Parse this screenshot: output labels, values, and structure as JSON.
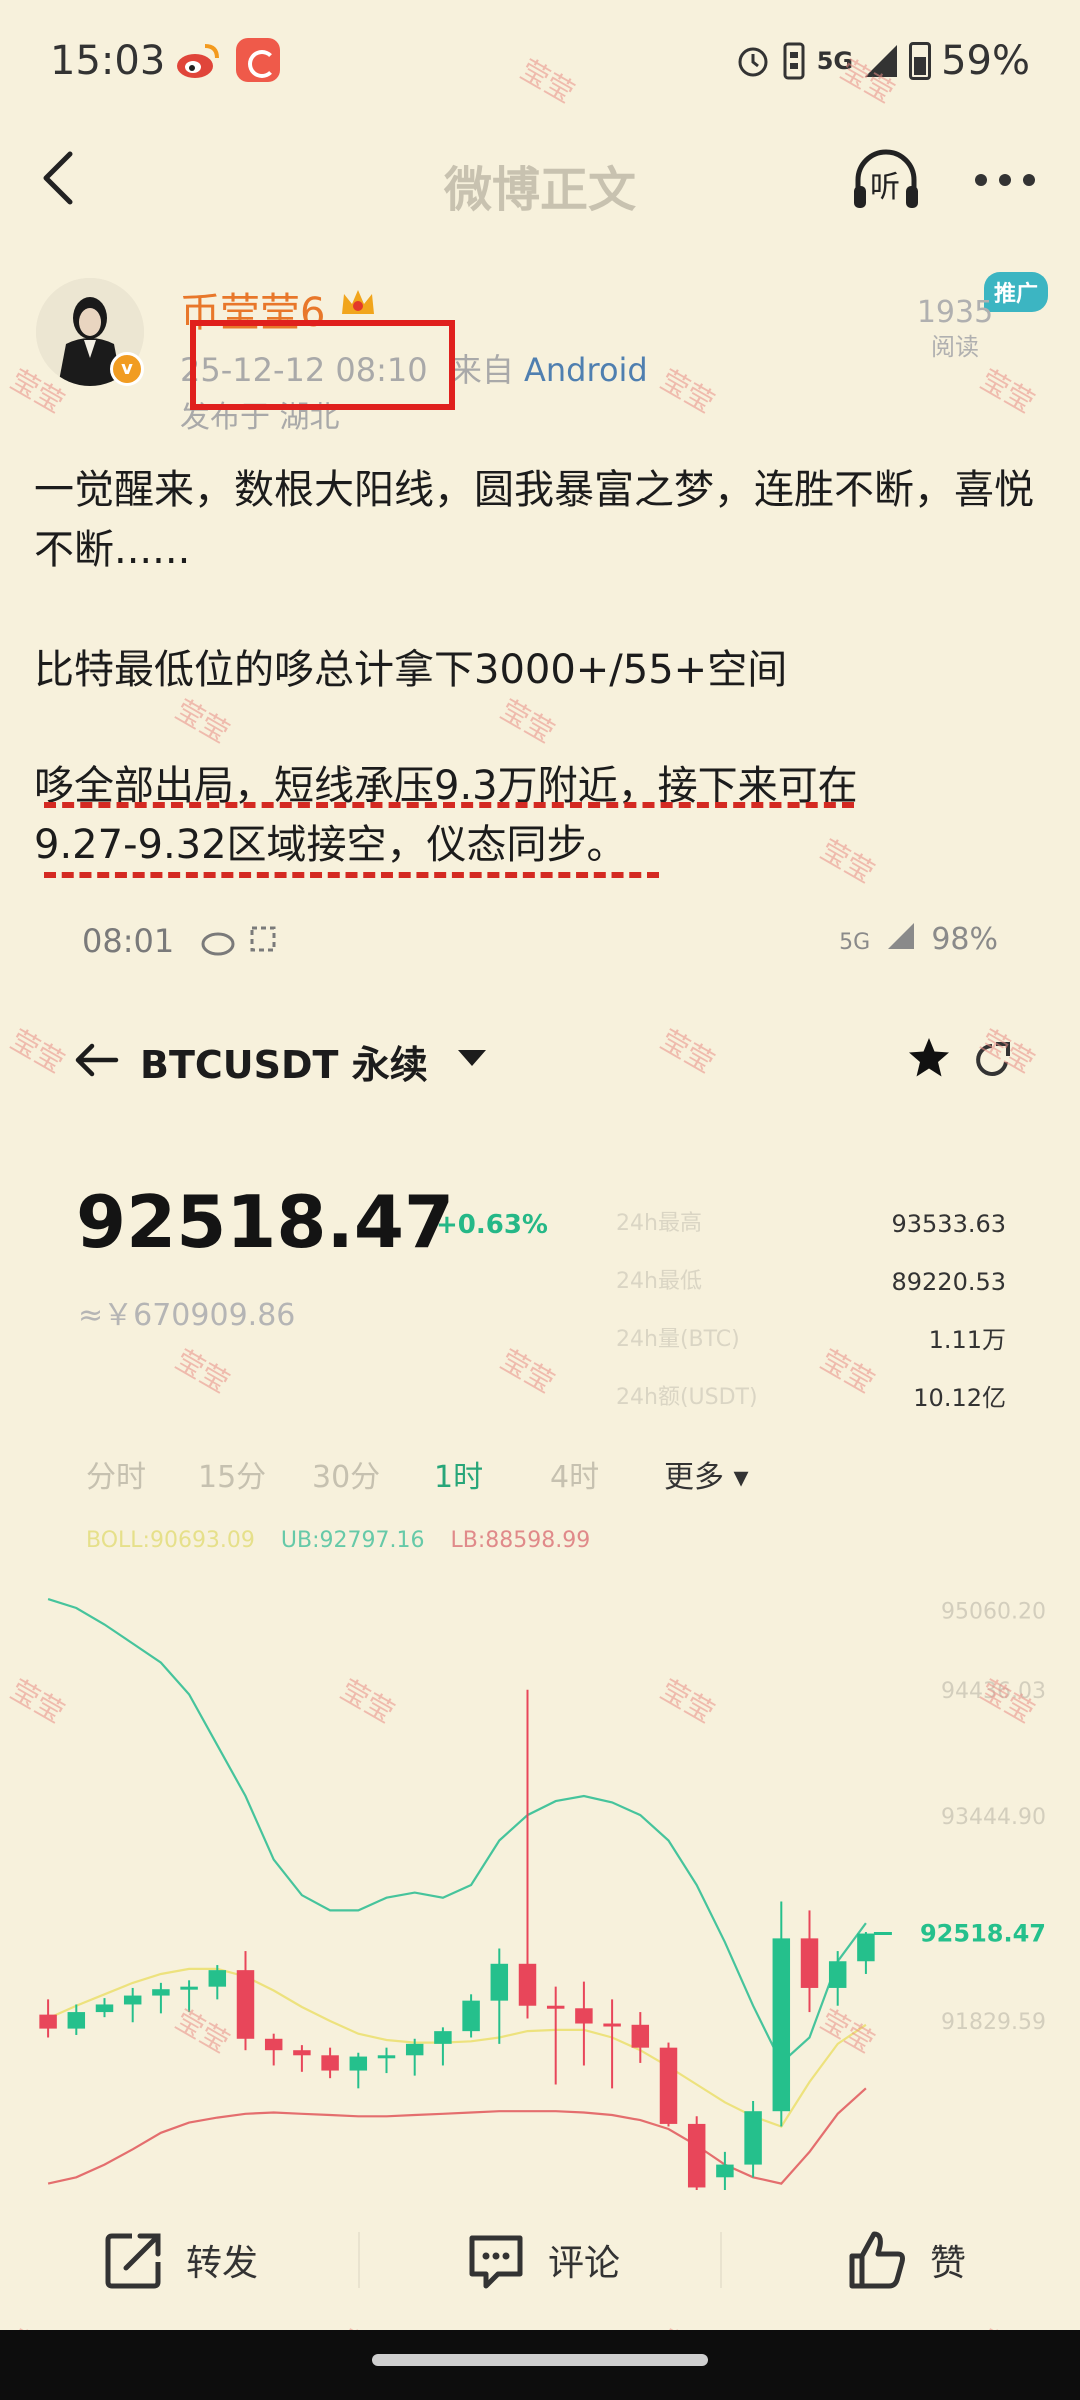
{
  "status_bar": {
    "time": "15:03",
    "network": "5G",
    "battery": "59%"
  },
  "nav": {
    "title": "微博正文",
    "listen": "听"
  },
  "author": {
    "name": "币莹莹6",
    "verified_mark": "v",
    "date": "25-12-12 08:10",
    "source_prefix": "来自",
    "source": "Android",
    "location": "发布于 湖北",
    "read_count": "1935",
    "read_label": "阅读",
    "promo": "推广"
  },
  "post": {
    "para1": "一觉醒来，数根大阳线，圆我暴富之梦，连胜不断，喜悦不断......",
    "para2": "比特最低位的哆总计拿下3000+/55+空间",
    "para3_line1": "哆全部出局，短线承压9.3万附近，接下来可在",
    "para3_line2": "9.27-9.32区域接空，仪态同步。"
  },
  "embedded": {
    "status_time": "08:01",
    "status_network": "5G",
    "status_battery": "98%",
    "symbol": "BTCUSDT 永续",
    "price": "92518.47",
    "change": "+0.63%",
    "price_cny": "≈￥670909.86",
    "stats": {
      "labels": [
        "24h最高",
        "24h最低",
        "24h量(BTC)",
        "24h额(USDT)"
      ],
      "values": [
        "93533.63",
        "89220.53",
        "1.11万",
        "10.12亿"
      ]
    },
    "timeframes": [
      "分时",
      "15分",
      "30分",
      "1时",
      "4时",
      "更多"
    ],
    "active_timeframe": "1时",
    "indicators": {
      "boll": "BOLL:90693.09",
      "ub": "UB:92797.16",
      "lb": "LB:88598.99"
    }
  },
  "chart_data": {
    "type": "candlestick",
    "title": "",
    "price_axis_labels": [
      "95060.20",
      "94436.03",
      "93444.90",
      "92518.47",
      "91829.59"
    ],
    "last_price": 92518.47,
    "ylim": [
      90500,
      95300
    ],
    "colors": {
      "up": "#25c08c",
      "down": "#e8465a",
      "ub": "#46c49c",
      "mid": "#ede27d",
      "lb": "#e46e6e"
    },
    "candles": [
      {
        "o": 91880,
        "h": 92000,
        "l": 91700,
        "c": 91770
      },
      {
        "o": 91770,
        "h": 91960,
        "l": 91720,
        "c": 91900
      },
      {
        "o": 91900,
        "h": 92010,
        "l": 91860,
        "c": 91960
      },
      {
        "o": 91960,
        "h": 92090,
        "l": 91820,
        "c": 92030
      },
      {
        "o": 92030,
        "h": 92130,
        "l": 91890,
        "c": 92080
      },
      {
        "o": 92080,
        "h": 92150,
        "l": 91900,
        "c": 92100
      },
      {
        "o": 92100,
        "h": 92270,
        "l": 92000,
        "c": 92230
      },
      {
        "o": 92230,
        "h": 92380,
        "l": 91600,
        "c": 91690
      },
      {
        "o": 91690,
        "h": 91730,
        "l": 91480,
        "c": 91600
      },
      {
        "o": 91600,
        "h": 91640,
        "l": 91430,
        "c": 91560
      },
      {
        "o": 91560,
        "h": 91620,
        "l": 91380,
        "c": 91440
      },
      {
        "o": 91440,
        "h": 91580,
        "l": 91300,
        "c": 91550
      },
      {
        "o": 91550,
        "h": 91620,
        "l": 91420,
        "c": 91560
      },
      {
        "o": 91560,
        "h": 91690,
        "l": 91400,
        "c": 91650
      },
      {
        "o": 91650,
        "h": 91780,
        "l": 91480,
        "c": 91750
      },
      {
        "o": 91750,
        "h": 92040,
        "l": 91700,
        "c": 91990
      },
      {
        "o": 91990,
        "h": 92400,
        "l": 91650,
        "c": 92280
      },
      {
        "o": 92280,
        "h": 94436,
        "l": 91850,
        "c": 91950
      },
      {
        "o": 91950,
        "h": 92100,
        "l": 91330,
        "c": 91930
      },
      {
        "o": 91930,
        "h": 92140,
        "l": 91480,
        "c": 91810
      },
      {
        "o": 91810,
        "h": 92000,
        "l": 91300,
        "c": 91800
      },
      {
        "o": 91800,
        "h": 91900,
        "l": 91500,
        "c": 91620
      },
      {
        "o": 91620,
        "h": 91660,
        "l": 91000,
        "c": 91020
      },
      {
        "o": 91020,
        "h": 91080,
        "l": 90500,
        "c": 90520
      },
      {
        "o": 90600,
        "h": 90800,
        "l": 90500,
        "c": 90700
      },
      {
        "o": 90700,
        "h": 91200,
        "l": 90600,
        "c": 91120
      },
      {
        "o": 91120,
        "h": 92770,
        "l": 91000,
        "c": 92480
      },
      {
        "o": 92480,
        "h": 92700,
        "l": 91900,
        "c": 92090
      },
      {
        "o": 92090,
        "h": 92380,
        "l": 91950,
        "c": 92300
      },
      {
        "o": 92300,
        "h": 92530,
        "l": 92200,
        "c": 92518
      }
    ],
    "boll_upper": [
      95150,
      95080,
      94950,
      94800,
      94650,
      94400,
      94000,
      93600,
      93100,
      92820,
      92700,
      92700,
      92800,
      92840,
      92800,
      92900,
      93250,
      93450,
      93560,
      93600,
      93550,
      93450,
      93250,
      92900,
      92450,
      91950,
      91500,
      91700,
      92300,
      92600
    ],
    "boll_mid": [
      91850,
      91950,
      92040,
      92130,
      92200,
      92240,
      92240,
      92180,
      92070,
      91940,
      91830,
      91730,
      91680,
      91660,
      91660,
      91670,
      91700,
      91750,
      91760,
      91760,
      91700,
      91600,
      91470,
      91330,
      91190,
      91080,
      91000,
      91350,
      91650,
      91800
    ],
    "boll_lower": [
      90550,
      90600,
      90700,
      90820,
      90950,
      91030,
      91070,
      91100,
      91110,
      91100,
      91090,
      91080,
      91080,
      91090,
      91100,
      91110,
      91120,
      91120,
      91120,
      91110,
      91090,
      91050,
      90980,
      90850,
      90700,
      90600,
      90550,
      90800,
      91100,
      91300
    ]
  },
  "actions": {
    "repost": "转发",
    "comment": "评论",
    "like": "赞"
  },
  "watermark": "莹莹"
}
